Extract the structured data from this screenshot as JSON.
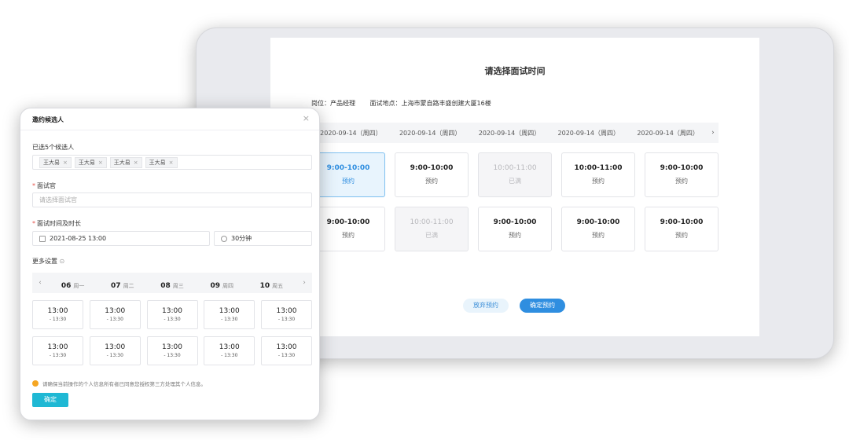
{
  "screen": {
    "title": "请选择面试时间",
    "position_label": "岗位：产品经理",
    "location_label": "面试地点：上海市蒙自路丰盛创建大厦16楼",
    "dates": [
      "2020-09-14（周四）",
      "2020-09-14（周四）",
      "2020-09-14（周四）",
      "2020-09-14（周四）",
      "2020-09-14（周四）"
    ],
    "next_arrow": "›",
    "slots": [
      {
        "time": "9:00-10:00",
        "status": "预约",
        "state": "selected"
      },
      {
        "time": "9:00-10:00",
        "status": "预约",
        "state": "normal"
      },
      {
        "time": "10:00-11:00",
        "status": "已满",
        "state": "full"
      },
      {
        "time": "10:00-11:00",
        "status": "预约",
        "state": "normal"
      },
      {
        "time": "9:00-10:00",
        "status": "预约",
        "state": "normal"
      },
      {
        "time": "9:00-10:00",
        "status": "预约",
        "state": "normal"
      },
      {
        "time": "10:00-11:00",
        "status": "已满",
        "state": "full"
      },
      {
        "time": "9:00-10:00",
        "status": "预约",
        "state": "normal"
      },
      {
        "time": "9:00-10:00",
        "status": "预约",
        "state": "normal"
      },
      {
        "time": "9:00-10:00",
        "status": "预约",
        "state": "normal"
      }
    ],
    "cancel_button": "放弃预约",
    "confirm_button": "确定预约"
  },
  "modal": {
    "title": "邀约候选人",
    "close": "×",
    "candidates_label": "已选5个候选人",
    "candidates": [
      "王大易",
      "王大易",
      "王大易",
      "王大易"
    ],
    "tag_close": "×",
    "required_mark": "*",
    "interviewer_label": "面试官",
    "interviewer_placeholder": "请选择面试官",
    "time_label": "面试时间及时长",
    "datetime_value": "2021-08-25  13:00",
    "duration_value": "30分钟",
    "more_settings": "更多设置",
    "more_settings_icon": "⊙",
    "prev_arrow": "‹",
    "next_arrow": "›",
    "days": [
      {
        "num": "06",
        "week": "周一"
      },
      {
        "num": "07",
        "week": "周二"
      },
      {
        "num": "08",
        "week": "周三"
      },
      {
        "num": "09",
        "week": "周四"
      },
      {
        "num": "10",
        "week": "周五"
      }
    ],
    "slot_time": "13:00",
    "slot_range": "- 13:30",
    "notice": "请确保当前操作的个人信息所有者已同意您授权第三方处理其个人信息。",
    "ok_button": "确定"
  },
  "colors": {
    "primary_blue": "#2f8ee0",
    "teal": "#1fb8d4",
    "warning": "#f5a623",
    "required": "#e5534b"
  }
}
